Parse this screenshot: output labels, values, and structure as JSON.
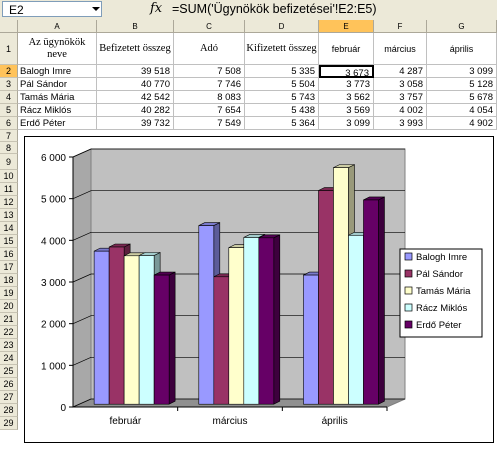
{
  "name_box": "E2",
  "fx_label": "fx",
  "formula": "=SUM('Ügynökök befizetései'!E2:E5)",
  "columns": [
    "A",
    "B",
    "C",
    "D",
    "E",
    "F",
    "G"
  ],
  "rows": [
    "1",
    "2",
    "3",
    "4",
    "5",
    "6",
    "7",
    "8",
    "9",
    "10",
    "11",
    "12",
    "13",
    "14",
    "15",
    "16",
    "17",
    "18",
    "19",
    "20",
    "21",
    "22",
    "23",
    "24",
    "25",
    "26",
    "27",
    "28",
    "29"
  ],
  "header_row": [
    "Az ügynökök neve",
    "Befizetett összeg",
    "Adó",
    "Kifizetett összeg",
    "február",
    "március",
    "április"
  ],
  "data_rows": [
    [
      "Balogh Imre",
      "39 518",
      "7 508",
      "5 335",
      "3 673",
      "4 287",
      "3 099"
    ],
    [
      "Pál Sándor",
      "40 770",
      "7 746",
      "5 504",
      "3 773",
      "3 058",
      "5 128"
    ],
    [
      "Tamás Mária",
      "42 542",
      "8 083",
      "5 743",
      "3 562",
      "3 757",
      "5 678"
    ],
    [
      "Rácz Miklós",
      "40 282",
      "7 654",
      "5 438",
      "3 569",
      "4 002",
      "4 054"
    ],
    [
      "Erdő Péter",
      "39 732",
      "7 549",
      "5 364",
      "3 099",
      "3 993",
      "4 902"
    ]
  ],
  "chart_data": {
    "type": "bar",
    "categories": [
      "február",
      "március",
      "április"
    ],
    "series": [
      {
        "name": "Balogh Imre",
        "values": [
          3673,
          4287,
          3099
        ],
        "color": "#9999ff"
      },
      {
        "name": "Pál Sándor",
        "values": [
          3773,
          3058,
          5128
        ],
        "color": "#993366"
      },
      {
        "name": "Tamás Mária",
        "values": [
          3562,
          3757,
          5678
        ],
        "color": "#ffffcc"
      },
      {
        "name": "Rácz Miklós",
        "values": [
          3569,
          4002,
          4054
        ],
        "color": "#ccffff"
      },
      {
        "name": "Erdő Péter",
        "values": [
          3099,
          3993,
          4902
        ],
        "color": "#660066"
      }
    ],
    "yticks": [
      "0",
      "1 000",
      "2 000",
      "3 000",
      "4 000",
      "5 000",
      "6 000"
    ],
    "ylim": [
      0,
      6000
    ],
    "grid": true,
    "legend_position": "right",
    "style": "3d-clustered-column"
  }
}
